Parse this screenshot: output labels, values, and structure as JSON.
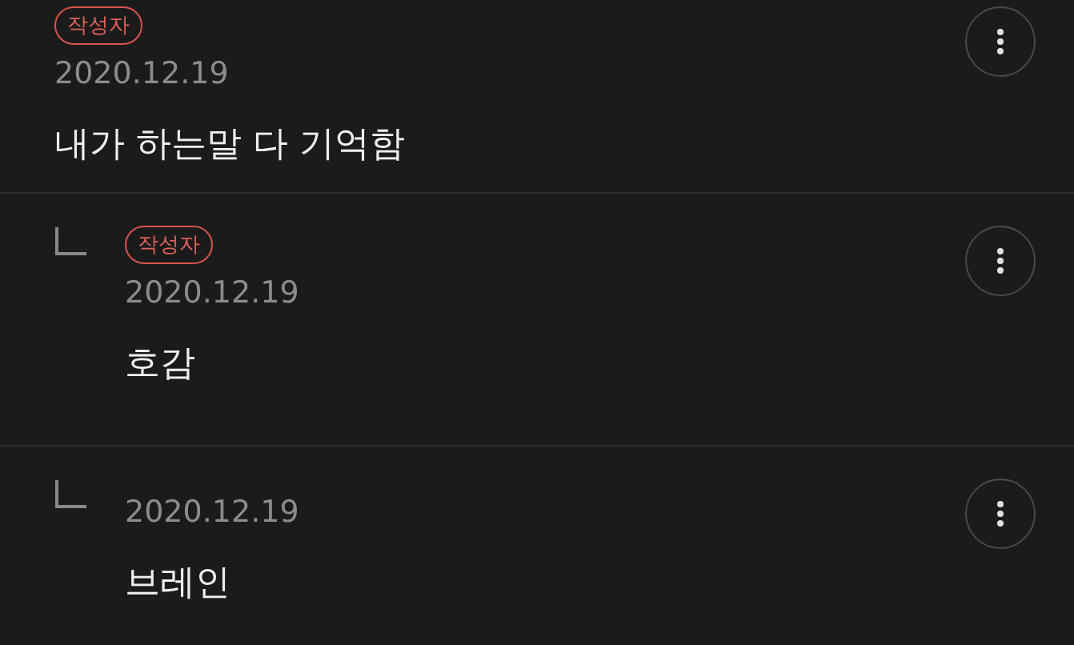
{
  "comments": [
    {
      "kind": "comment",
      "badge": "작성자",
      "date": "2020.12.19",
      "text": "내가 하는말 다 기억함"
    },
    {
      "kind": "reply",
      "badge": "작성자",
      "date": "2020.12.19",
      "text": "호감"
    },
    {
      "kind": "reply",
      "date": "2020.12.19",
      "text": "브레인"
    }
  ]
}
